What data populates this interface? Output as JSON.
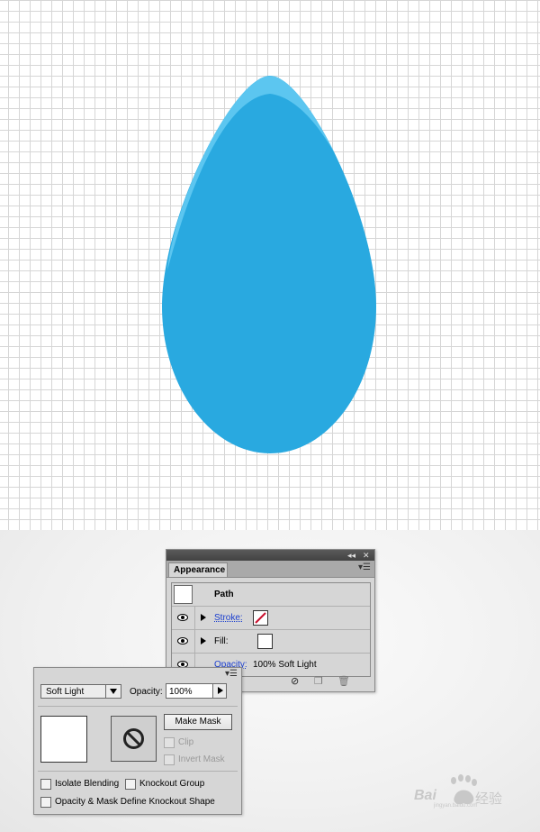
{
  "colors": {
    "drop_fill": "#29a9e0",
    "drop_highlight": "#5cc6f0",
    "stroke_swatch_slash": "#c8102e",
    "link_blue": "#1a3ecf"
  },
  "appearance_panel": {
    "title": "Appearance",
    "collapse_icon": "double-chevron-left-icon",
    "close_icon": "close-icon",
    "menu_icon": "panel-menu-icon",
    "path_label": "Path",
    "rows": {
      "stroke": {
        "label": "Stroke:",
        "swatch": "none-swatch"
      },
      "fill": {
        "label": "Fill:",
        "swatch": "white-swatch"
      },
      "opacity": {
        "label": "Opacity:",
        "value": "100% Soft Light"
      }
    },
    "footer": [
      "clear-appearance-icon",
      "duplicate-item-icon",
      "delete-item-icon"
    ]
  },
  "transparency_panel": {
    "blend_mode": "Soft Light",
    "opacity_label": "Opacity:",
    "opacity_value": "100%",
    "make_mask_label": "Make Mask",
    "clip_label": "Clip",
    "invert_mask_label": "Invert Mask",
    "isolate_blending_label": "Isolate Blending",
    "knockout_group_label": "Knockout Group",
    "opacity_mask_label": "Opacity & Mask Define Knockout Shape"
  },
  "watermark": {
    "text": "Bai",
    "suffix": "经验",
    "domain": "jingyan.baidu.com"
  }
}
